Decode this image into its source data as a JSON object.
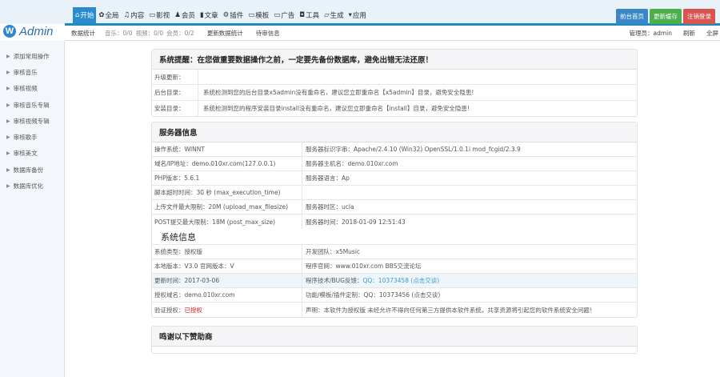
{
  "logo": {
    "letter": "W",
    "text": "Admin"
  },
  "nav": [
    {
      "icon": "home-icon",
      "glyph": "⌂",
      "label": "开始"
    },
    {
      "icon": "gear-icon",
      "glyph": "✿",
      "label": "全局"
    },
    {
      "icon": "music-icon",
      "glyph": "♫",
      "label": "内容"
    },
    {
      "icon": "monitor-icon",
      "glyph": "▭",
      "label": "影视"
    },
    {
      "icon": "user-icon",
      "glyph": "♟",
      "label": "会员"
    },
    {
      "icon": "document-icon",
      "glyph": "▮",
      "label": "文章"
    },
    {
      "icon": "plugin-icon",
      "glyph": "⚙",
      "label": "插件"
    },
    {
      "icon": "monitor-icon",
      "glyph": "▭",
      "label": "模板"
    },
    {
      "icon": "laptop-icon",
      "glyph": "▭",
      "label": "广告"
    },
    {
      "icon": "shield-icon",
      "glyph": "◘",
      "label": "工具"
    },
    {
      "icon": "folder-icon",
      "glyph": "▱",
      "label": "生成"
    },
    {
      "icon": "cart-icon",
      "glyph": "▾",
      "label": "应用"
    }
  ],
  "buttons": [
    {
      "label": "前台首页",
      "color": "#3a87c8"
    },
    {
      "label": "更新缓存",
      "color": "#4cae4c"
    },
    {
      "label": "注销登录",
      "color": "#d9534f"
    }
  ],
  "sub": {
    "stats_label": "数据统计",
    "music": "音乐：0/0",
    "video": "视频：0/0",
    "members": "会员：0/2",
    "update": "更新数据统计",
    "pending": "待审信息",
    "admin": "管理员：admin",
    "refresh": "刷新",
    "fullscreen": "全屏"
  },
  "sidebar": [
    "添加常用操作",
    "审核音乐",
    "审核视频",
    "审核音乐专辑",
    "审核视频专辑",
    "审核歌手",
    "审核美文",
    "数据库备份",
    "数据库优化"
  ],
  "notice": {
    "title": "系统提醒：在您做重要数据操作之前，一定要先备份数据库，避免出错无法还原！",
    "rows": [
      {
        "k": "升级更新：",
        "v": ""
      },
      {
        "k": "后台目录：",
        "v": "系统检测到您的后台目录x5admin没有重命名，建议您立即重命名【x5admin】目录，避免安全隐患!"
      },
      {
        "k": "安装目录：",
        "v": "系统检测到您的程序安装目录install没有重命名，建议您立即重命名【install】目录，避免安全隐患!"
      }
    ]
  },
  "server": {
    "title": "服务器信息",
    "rows": [
      [
        "操作系统：WINNT",
        "服务器标识字串：Apache/2.4.10 (Win32) OpenSSL/1.0.1i mod_fcgid/2.3.9"
      ],
      [
        "域名/IP地址：demo.010xr.com(127.0.0.1)",
        "服务器主机名：demo.010xr.com"
      ],
      [
        "PHP版本：5.6.1",
        "服务器语言：Ap"
      ],
      [
        "脚本超时时间：30 秒 (max_execution_time)",
        ""
      ],
      [
        "上传文件最大限制：20M (upload_max_filesize)",
        "服务器时区：ucla"
      ],
      [
        "POST提交最大限制：18M (post_max_size)",
        "服务器时间：2018-01-09 12:51:43"
      ]
    ]
  },
  "system": {
    "title": "系统信息",
    "rows": [
      {
        "l": "系统类型：授权版",
        "r": "开发团队：x5Music"
      },
      {
        "l": "本地版本：V3.0   官网版本：V",
        "r": "程序官网：www.010xr.com   BBS交流论坛"
      },
      {
        "l": "更新时间：2017-03-06",
        "r_label": "程序技术/BUG反馈：",
        "r_link": "QQ：10373458 (点击交谈)"
      },
      {
        "l": "授权域名：demo.010xr.com",
        "r": "功能/模板/插件定制：QQ：10373456 (点击交谈)"
      },
      {
        "l_label": "验证授权：",
        "l_status": "已授权",
        "r": "声明：本软件为授权版 未经允许不得向任何第三方提供本软件系统，共享资源将引起您的软件系统安全问题！"
      }
    ]
  },
  "sponsors": {
    "title": "鸣谢以下赞助商"
  }
}
